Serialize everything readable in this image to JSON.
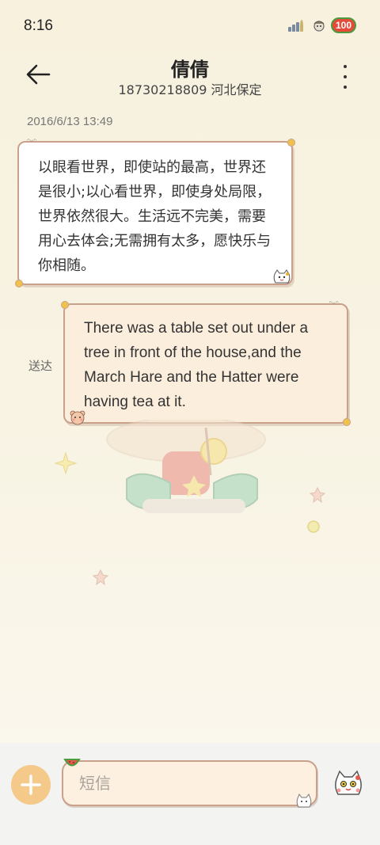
{
  "status_bar": {
    "time": "8:16",
    "battery": "100",
    "icons": [
      "signal-icon",
      "toy-icon",
      "battery-icon"
    ]
  },
  "header": {
    "contact_name": "倩倩",
    "contact_sub": "18730218809 河北保定",
    "back_icon": "arrow-left-icon",
    "more_icon": "more-vertical-icon"
  },
  "conversation": {
    "timestamp": "2016/6/13 13:49",
    "incoming_message": "以眼看世界，即使站的最高，世界还是很小;以心看世界，即使身处局限，世界依然很大。生活远不完美，需要用心去体会;无需拥有太多，愿快乐与你相随。",
    "outgoing_message": "There was a table set out under a tree in front of the house,and the March Hare and the Hatter were having tea at it.",
    "sent_status": "送达"
  },
  "composer": {
    "placeholder": "短信",
    "value": "",
    "add_icon": "plus-icon",
    "emoji_icon": "lucky-cat-icon"
  },
  "colors": {
    "accent": "#f4c98a",
    "bubble_border": "#c9a08a",
    "outgoing_bubble": "#fbeedd",
    "battery": "#e64b3a"
  }
}
